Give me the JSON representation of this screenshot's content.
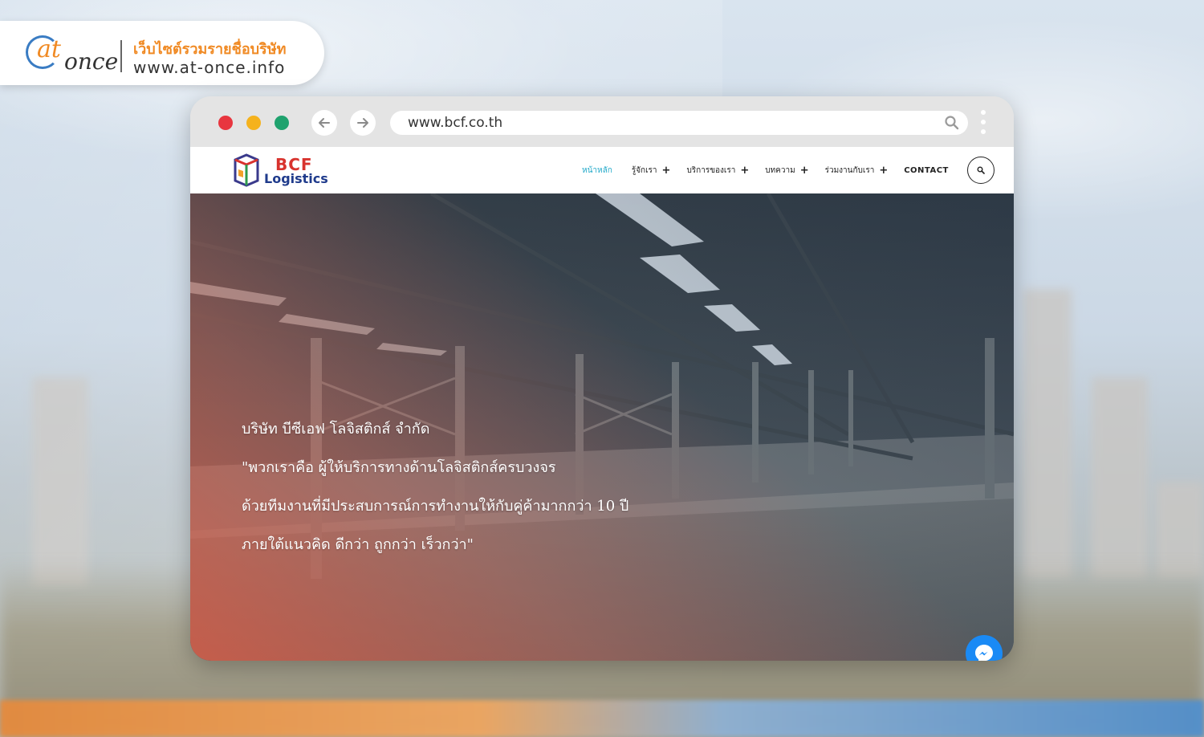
{
  "badge": {
    "title": "เว็บไซต์รวมรายชื่อบริษัท",
    "url": "www.at-once.info",
    "logo_at": "at",
    "logo_once": "once"
  },
  "browser": {
    "address": "www.bcf.co.th"
  },
  "site": {
    "logo_bcf": "BCF",
    "logo_logistics": "Logistics",
    "menu": [
      {
        "label": "หน้าหลัก",
        "has_plus": false,
        "active": true
      },
      {
        "label": "รู้จักเรา",
        "has_plus": true
      },
      {
        "label": "บริการของเรา",
        "has_plus": true
      },
      {
        "label": "บทความ",
        "has_plus": true
      },
      {
        "label": "ร่วมงานกับเรา",
        "has_plus": true
      },
      {
        "label": "CONTACT",
        "has_plus": false
      }
    ],
    "plus_symbol": "+"
  },
  "hero": {
    "lines": [
      "บริษัท บีซีเอฟ โลจิสติกส์ จำกัด",
      "\"พวกเราคือ ผู้ให้บริการทางด้านโลจิสติกส์ครบวงจร",
      "ด้วยทีมงานที่มีประสบการณ์การทำงานให้กับคู่ค้ามากกว่า 10 ปี",
      "ภายใต้แนวคิด ดีกว่า ถูกกว่า เร็วกว่า\""
    ]
  },
  "colors": {
    "accent_active_menu": "#22a9c9",
    "badge_orange": "#f08a24",
    "messenger_blue": "#1a8af5"
  },
  "icons": [
    "back-arrow-icon",
    "forward-arrow-icon",
    "search-icon",
    "kebab-menu-icon",
    "messenger-icon"
  ]
}
